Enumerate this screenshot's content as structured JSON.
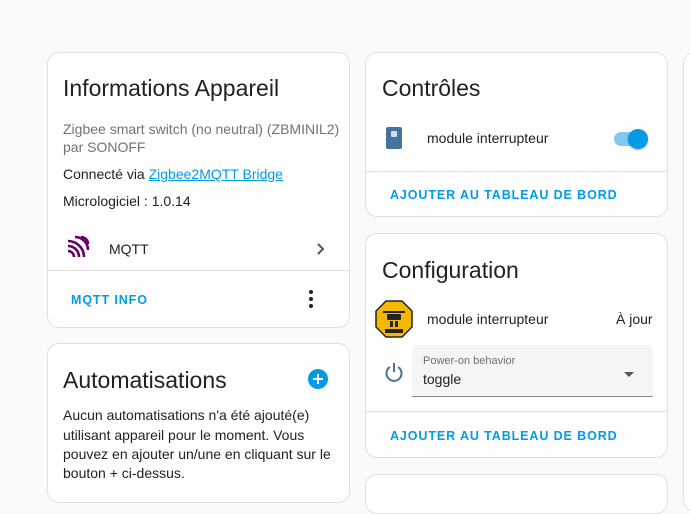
{
  "device_info": {
    "title": "Informations Appareil",
    "model_line1": "Zigbee smart switch (no neutral) (ZBMINIL2)",
    "model_line2": "par SONOFF",
    "connected_prefix": "Connecté via ",
    "connected_link": "Zigbee2MQTT Bridge",
    "firmware": "Micrologiciel : 1.0.14",
    "integration_label": "MQTT",
    "action_label": "MQTT INFO",
    "mqtt_color": "#660066"
  },
  "automations": {
    "title": "Automatisations",
    "line1": "Aucun automatisations n'a été ajouté(e)",
    "line2": "utilisant appareil pour le moment. Vous",
    "line3": "pouvez en ajouter un/une en cliquant sur le",
    "line4": "bouton + ci-dessus."
  },
  "controls": {
    "title": "Contrôles",
    "entity_name": "module interrupteur",
    "switch_on": true,
    "action_label": "AJOUTER AU TABLEAU DE BORD"
  },
  "configuration": {
    "title": "Configuration",
    "update_entity": "module interrupteur",
    "update_status": "À jour",
    "select_label": "Power-on behavior",
    "select_value": "toggle",
    "action_label": "AJOUTER AU TABLEAU DE BORD"
  },
  "colors": {
    "accent": "#039be5",
    "icon_blue": "#44739e",
    "mqtt_purple": "#660066",
    "badge_yellow": "#f5b800"
  }
}
